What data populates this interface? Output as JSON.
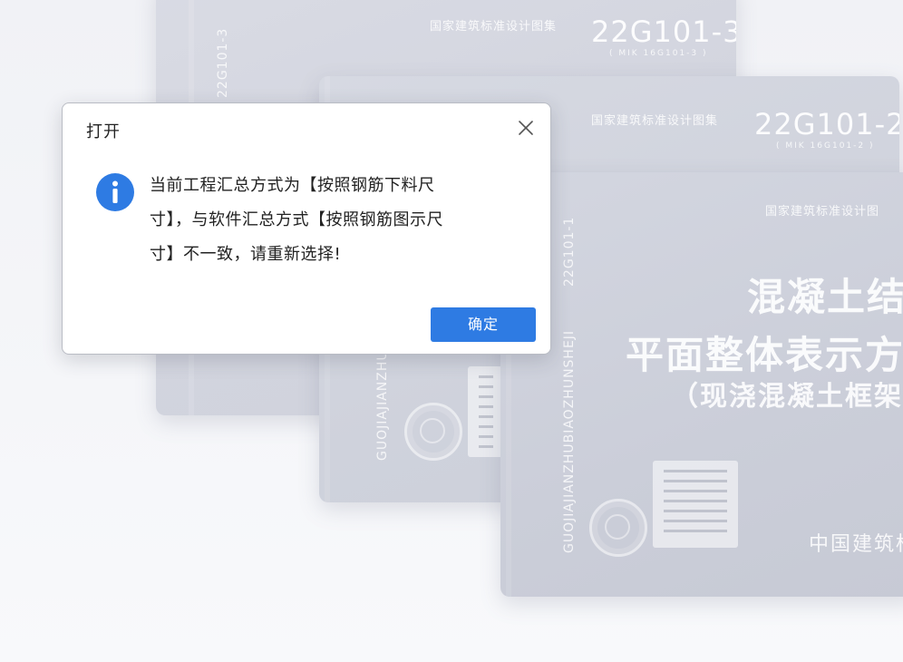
{
  "dialog": {
    "title": "打开",
    "message_lines": [
      "当前工程汇总方式为【按照钢筋下料尺",
      "寸】，与软件汇总方式【按照钢筋图示尺",
      "寸】不一致，请重新选择!"
    ],
    "ok_label": "确定",
    "accent_color": "#2e7be3"
  },
  "background": {
    "book_3": {
      "series": "国家建筑标准设计图集",
      "code": "22G101-3",
      "subcode": "( MIK 16G101-3 )",
      "spine": "22G101-3"
    },
    "book_2": {
      "series": "国家建筑标准设计图集",
      "code": "22G101-2",
      "subcode": "( MIK 16G101-2 )",
      "spine": "GUOJIAJIANZHUBIAOZHUNSHEJI"
    },
    "book_1": {
      "series": "国家建筑标准设计图",
      "spine_code": "22G101-1",
      "spine": "GUOJIAJIANZHUBIAOZHUNSHEJI",
      "title_line1": "混凝土结构施",
      "title_line2": "平面整体表示方法制图规",
      "title_line3": "（现浇混凝土框架、剪力",
      "publisher": "中国建筑标"
    }
  }
}
